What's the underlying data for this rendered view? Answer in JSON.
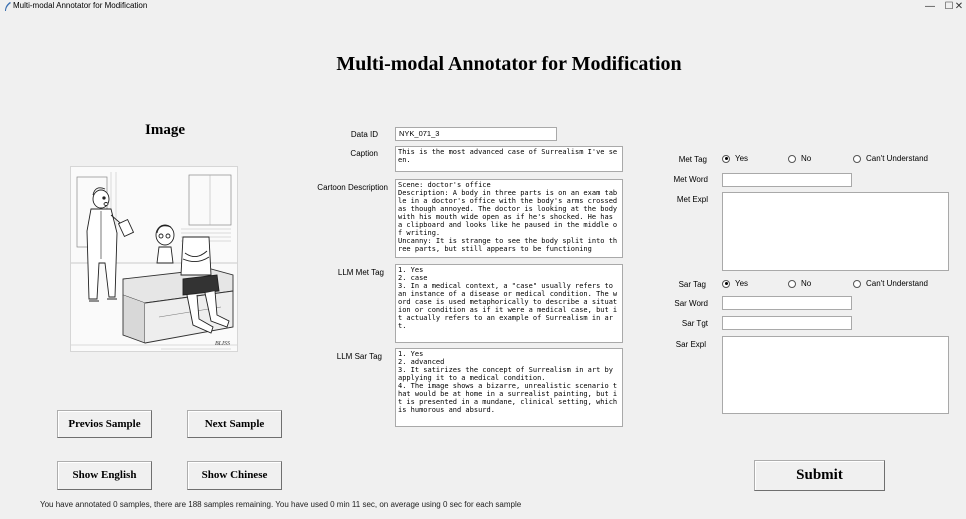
{
  "window": {
    "title": "Multi-modal Annotator for Modification",
    "minimize": "—",
    "maximize": "☐",
    "close": "✕"
  },
  "page_title": "Multi-modal Annotator for Modification",
  "image_heading": "Image",
  "image": {
    "alt": "Cartoon: doctor with clipboard looking at a body split into three parts on an exam table",
    "signature": "BLISS"
  },
  "fields": {
    "data_id": {
      "label": "Data ID",
      "value": "NYK_071_3"
    },
    "caption": {
      "label": "Caption",
      "value": "This is the most advanced case of Surrealism I've seen."
    },
    "cartoon_description": {
      "label": "Cartoon Description",
      "value": "Scene: doctor's office\nDescription: A body in three parts is on an exam table in a doctor's office with the body's arms crossed as though annoyed. The doctor is looking at the body with his mouth wide open as if he's shocked. He has a clipboard and looks like he paused in the middle of writing.\nUncanny: It is strange to see the body split into three parts, but still appears to be functioning"
    },
    "llm_met_tag": {
      "label": "LLM Met Tag",
      "value": "1. Yes\n2. case\n3. In a medical context, a \"case\" usually refers to an instance of a disease or medical condition. The word case is used metaphorically to describe a situation or condition as if it were a medical case, but it actually refers to an example of Surrealism in art."
    },
    "llm_sar_tag": {
      "label": "LLM Sar Tag",
      "value": "1. Yes\n2. advanced\n3. It satirizes the concept of Surrealism in art by applying it to a medical condition.\n4. The image shows a bizarre, unrealistic scenario that would be at home in a surrealist painting, but it is presented in a mundane, clinical setting, which is humorous and absurd."
    }
  },
  "met": {
    "tag_label": "Met Tag",
    "options": [
      "Yes",
      "No",
      "Can't Understand"
    ],
    "selected": "Yes",
    "word_label": "Met Word",
    "word_value": "",
    "expl_label": "Met Expl",
    "expl_value": ""
  },
  "sar": {
    "tag_label": "Sar Tag",
    "options": [
      "Yes",
      "No",
      "Can't Understand"
    ],
    "selected": "Yes",
    "word_label": "Sar Word",
    "word_value": "",
    "tgt_label": "Sar Tgt",
    "tgt_value": "",
    "expl_label": "Sar Expl",
    "expl_value": ""
  },
  "buttons": {
    "previous": "Previos Sample",
    "next": "Next Sample",
    "show_english": "Show English",
    "show_chinese": "Show Chinese",
    "submit": "Submit"
  },
  "status": "You have annotated 0 samples, there are 188 samples remaining. You have used 0 min 11 sec, on average using 0 sec for each sample"
}
